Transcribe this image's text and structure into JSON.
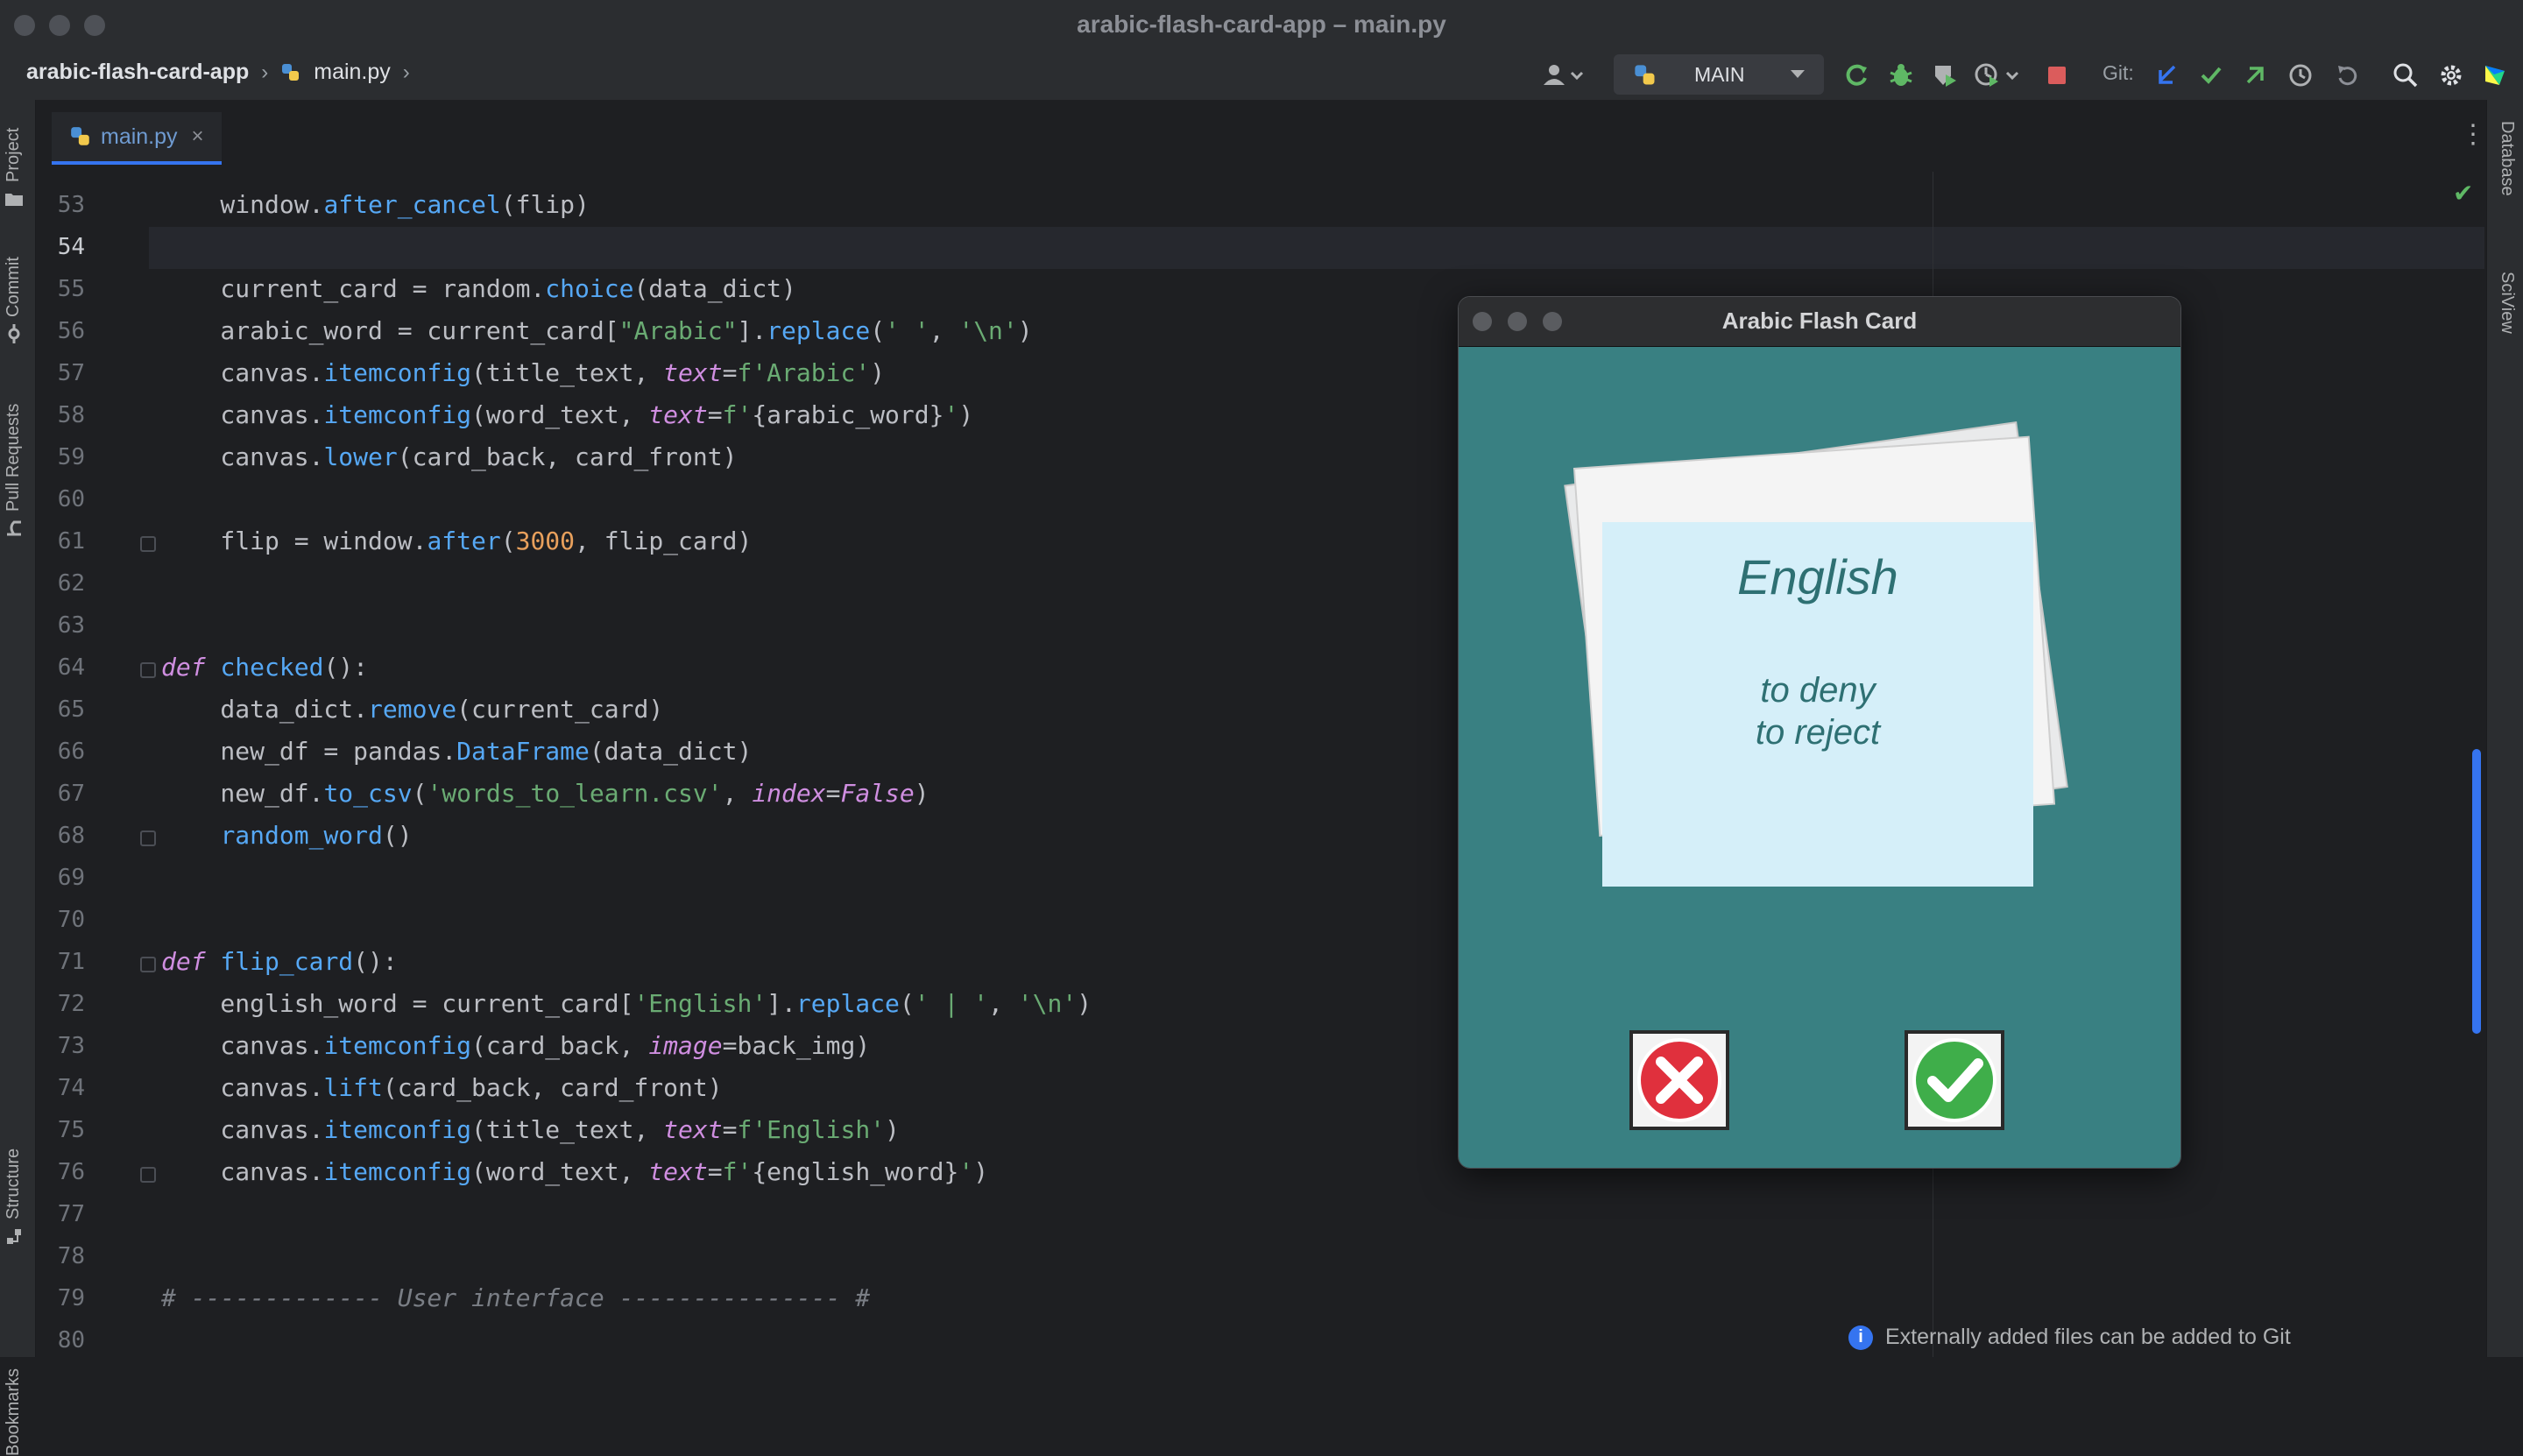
{
  "window": {
    "title": "arabic-flash-card-app – main.py"
  },
  "breadcrumb": {
    "project": "arabic-flash-card-app",
    "file": "main.py"
  },
  "toolbar": {
    "run_config": "MAIN",
    "git_label": "Git:"
  },
  "left_tools": [
    "Project",
    "Commit",
    "Pull Requests",
    "Structure",
    "Bookmarks"
  ],
  "right_tools": [
    "Database",
    "SciView"
  ],
  "tabs": [
    {
      "label": "main.py",
      "close": "×"
    }
  ],
  "editor": {
    "current_line": 54,
    "lines": [
      {
        "n": 53,
        "html": "    window.<span class=\"fn\">after_cancel</span>(flip)"
      },
      {
        "n": 54,
        "html": ""
      },
      {
        "n": 55,
        "html": "    current_card = random.<span class=\"fn\">choice</span>(data_dict)"
      },
      {
        "n": 56,
        "html": "    arabic_word = current_card[<span class=\"str\">\"Arabic\"</span>].<span class=\"fn\">replace</span>(<span class=\"str\">' '</span>, <span class=\"str\">'\\n'</span>)"
      },
      {
        "n": 57,
        "html": "    canvas.<span class=\"fn\">itemconfig</span>(title_text, <span class=\"pm\">text</span>=<span class=\"str\">f'Arabic'</span>)"
      },
      {
        "n": 58,
        "html": "    canvas.<span class=\"fn\">itemconfig</span>(word_text, <span class=\"pm\">text</span>=<span class=\"str\">f'</span>{arabic_word}<span class=\"str\">'</span>)"
      },
      {
        "n": 59,
        "html": "    canvas.<span class=\"fn\">lower</span>(card_back, card_front)"
      },
      {
        "n": 60,
        "html": ""
      },
      {
        "n": 61,
        "html": "    flip = window.<span class=\"fn\">after</span>(<span class=\"fl\">3000</span>, flip_card)"
      },
      {
        "n": 62,
        "html": ""
      },
      {
        "n": 63,
        "html": ""
      },
      {
        "n": 64,
        "html": "<span class=\"kw\">def</span> <span class=\"fn\">checked</span>():"
      },
      {
        "n": 65,
        "html": "    data_dict.<span class=\"fn\">remove</span>(current_card)"
      },
      {
        "n": 66,
        "html": "    new_df = pandas.<span class=\"fn\">DataFrame</span>(data_dict)"
      },
      {
        "n": 67,
        "html": "    new_df.<span class=\"fn\">to_csv</span>(<span class=\"str\">'words_to_learn.csv'</span>, <span class=\"pm\">index</span>=<span class=\"kw\">False</span>)"
      },
      {
        "n": 68,
        "html": "    <span class=\"fn\">random_word</span>()"
      },
      {
        "n": 69,
        "html": ""
      },
      {
        "n": 70,
        "html": ""
      },
      {
        "n": 71,
        "html": "<span class=\"kw\">def</span> <span class=\"fn\">flip_card</span>():"
      },
      {
        "n": 72,
        "html": "    english_word = current_card[<span class=\"str\">'English'</span>].<span class=\"fn\">replace</span>(<span class=\"str\">' | '</span>, <span class=\"str\">'\\n'</span>)"
      },
      {
        "n": 73,
        "html": "    canvas.<span class=\"fn\">itemconfig</span>(card_back, <span class=\"pm\">image</span>=back_img)"
      },
      {
        "n": 74,
        "html": "    canvas.<span class=\"fn\">lift</span>(card_back, card_front)"
      },
      {
        "n": 75,
        "html": "    canvas.<span class=\"fn\">itemconfig</span>(title_text, <span class=\"pm\">text</span>=<span class=\"str\">f'English'</span>)"
      },
      {
        "n": 76,
        "html": "    canvas.<span class=\"fn\">itemconfig</span>(word_text, <span class=\"pm\">text</span>=<span class=\"str\">f'</span>{english_word}<span class=\"str\">'</span>)"
      },
      {
        "n": 77,
        "html": ""
      },
      {
        "n": 78,
        "html": ""
      },
      {
        "n": 79,
        "html": "<span class=\"cmt\"># ------------- User interface --------------- #</span>"
      },
      {
        "n": 80,
        "html": ""
      }
    ]
  },
  "notification": {
    "text": "Externally added files can be added to Git"
  },
  "flash_app": {
    "title": "Arabic Flash Card",
    "card_title": "English",
    "card_word": "to deny\nto reject",
    "colors": {
      "background": "#398082",
      "card": "#d5eff9",
      "text": "#2e7073"
    }
  }
}
